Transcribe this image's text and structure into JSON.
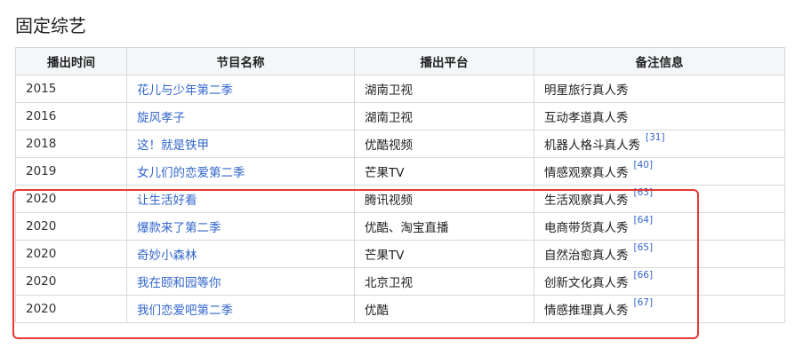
{
  "section": {
    "title": "固定综艺"
  },
  "table": {
    "headers": [
      "播出时间",
      "节目名称",
      "播出平台",
      "备注信息"
    ],
    "rows": [
      {
        "year": "2015",
        "name": "花儿与少年第二季",
        "platform": "湖南卫视",
        "note": "明星旅行真人秀",
        "ref": ""
      },
      {
        "year": "2016",
        "name": "旋风孝子",
        "platform": "湖南卫视",
        "note": "互动孝道真人秀",
        "ref": ""
      },
      {
        "year": "2018",
        "name": "这！就是铁甲",
        "platform": "优酷视频",
        "note": "机器人格斗真人秀",
        "ref": "[31]"
      },
      {
        "year": "2019",
        "name": "女儿们的恋爱第二季",
        "platform": "芒果TV",
        "note": "情感观察真人秀",
        "ref": "[40]"
      },
      {
        "year": "2020",
        "name": "让生活好看",
        "platform": "腾讯视频",
        "note": "生活观察真人秀",
        "ref": "[63]"
      },
      {
        "year": "2020",
        "name": "爆款来了第二季",
        "platform": "优酷、淘宝直播",
        "note": "电商带货真人秀",
        "ref": "[64]"
      },
      {
        "year": "2020",
        "name": "奇妙小森林",
        "platform": "芒果TV",
        "note": "自然治愈真人秀",
        "ref": "[65]"
      },
      {
        "year": "2020",
        "name": "我在颐和园等你",
        "platform": "北京卫视",
        "note": "创新文化真人秀",
        "ref": "[66]"
      },
      {
        "year": "2020",
        "name": "我们恋爱吧第二季",
        "platform": "优酷",
        "note": "情感推理真人秀",
        "ref": "[67]"
      }
    ]
  },
  "colors": {
    "link": "#3366cc",
    "highlight": "#e53935",
    "header_bg": "#f5f6f7",
    "border": "#d6d8db"
  }
}
